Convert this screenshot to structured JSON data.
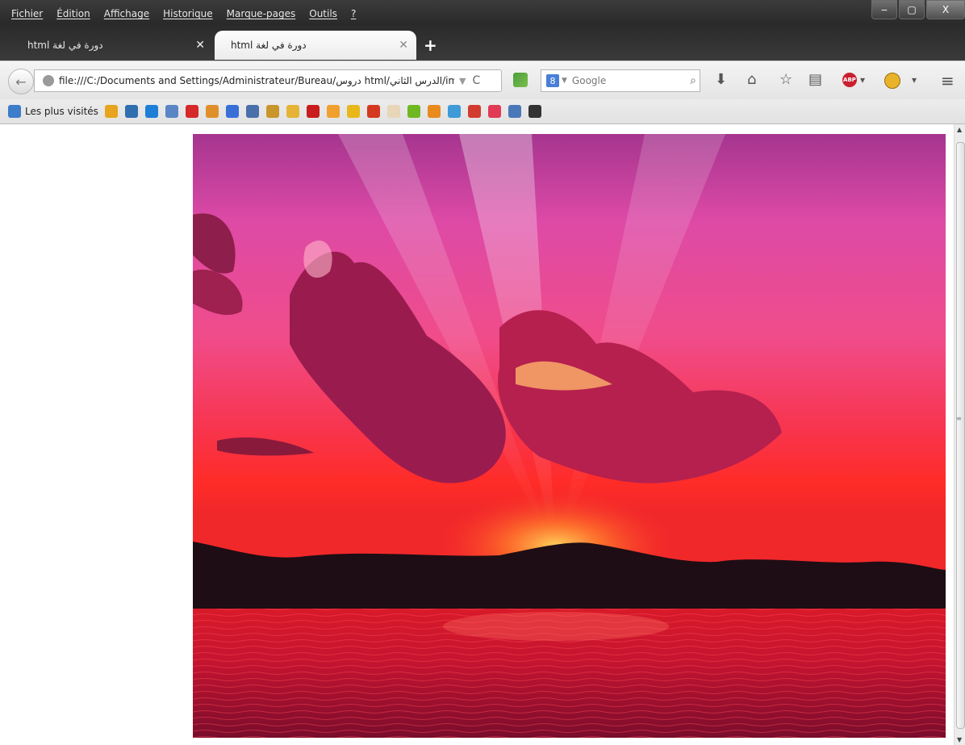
{
  "menu": [
    "Fichier",
    "Édition",
    "Affichage",
    "Historique",
    "Marque-pages",
    "Outils",
    "?"
  ],
  "window_controls": {
    "minimize": "‒",
    "maximize": "▢",
    "close": "X"
  },
  "tabs": [
    {
      "label": "html دورة في لغة",
      "close": "✕",
      "active": false
    },
    {
      "label": "html دورة في لغة",
      "close": "✕",
      "active": true
    }
  ],
  "new_tab": "+",
  "nav": {
    "back": "←",
    "url": "file:///C:/Documents and Settings/Administrateur/Bureau/دروس html/الدرس الثاني/image.",
    "url_dropdown": "▼",
    "reload": "C",
    "search": {
      "engine_badge": "8",
      "dropdown": "▼",
      "placeholder": "Google",
      "button": "⌕"
    }
  },
  "toolbar_icons": {
    "download": "⬇",
    "home": "⌂",
    "bookmark_star": "☆",
    "bookmarks_list": "▤",
    "abp": "ABP",
    "abp_dropdown": "▾",
    "gm_dropdown": "▾",
    "menu": "≡"
  },
  "bookmarks_bar": {
    "label": "Les plus visités",
    "favicons": [
      {
        "name": "sab-icon",
        "color": "#e6a41f"
      },
      {
        "name": "blue-square-icon",
        "color": "#2f6fb0"
      },
      {
        "name": "circle-arrow-icon",
        "color": "#1f7fd6"
      },
      {
        "name": "n-icon",
        "color": "#5b86c6"
      },
      {
        "name": "c-red-icon",
        "color": "#d62a2a"
      },
      {
        "name": "leaf-icon",
        "color": "#e0902a"
      },
      {
        "name": "pen-icon",
        "color": "#3870d8"
      },
      {
        "name": "photo-icon",
        "color": "#4b6fa8"
      },
      {
        "name": "shield-icon",
        "color": "#c9962c"
      },
      {
        "name": "ebay-icon",
        "color": "#e5b437"
      },
      {
        "name": "red-block-icon",
        "color": "#c91c1c"
      },
      {
        "name": "amazon-icon",
        "color": "#f0a02c"
      },
      {
        "name": "fnac-icon",
        "color": "#e8b81b"
      },
      {
        "name": "darty-icon",
        "color": "#d4381e"
      },
      {
        "name": "face-icon",
        "color": "#e8d6b8"
      },
      {
        "name": "green-circle-icon",
        "color": "#6fb822"
      },
      {
        "name": "fire-icon",
        "color": "#e88a1c"
      },
      {
        "name": "gamepad-icon",
        "color": "#3f9ad8"
      },
      {
        "name": "gmail-icon",
        "color": "#d23c2f"
      },
      {
        "name": "s-circle-icon",
        "color": "#e03a55"
      },
      {
        "name": "people-icon",
        "color": "#4b78b8"
      },
      {
        "name": "h-script-icon",
        "color": "#333333"
      }
    ]
  },
  "scrollbar": {
    "up": "▲",
    "down": "▼",
    "grip": "≡"
  }
}
